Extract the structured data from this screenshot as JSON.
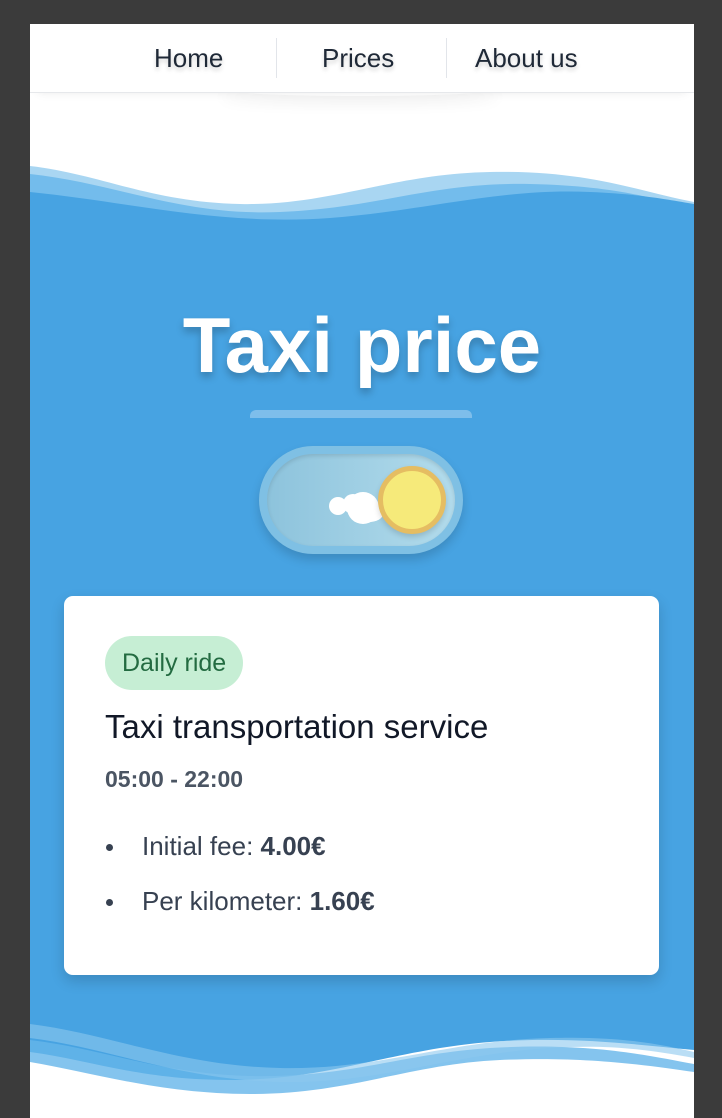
{
  "nav": {
    "items": [
      {
        "label": "Home"
      },
      {
        "label": "Prices"
      },
      {
        "label": "About us"
      }
    ]
  },
  "hero": {
    "title": "Taxi price",
    "toggle": {
      "state": "day",
      "icon_on": "sun-icon",
      "icon_off": "cloud-icon"
    }
  },
  "card": {
    "badge": "Daily ride",
    "title": "Taxi transportation service",
    "hours": "05:00 - 22:00",
    "prices": [
      {
        "label": "Initial fee: ",
        "value": "4.00€"
      },
      {
        "label": "Per kilometer: ",
        "value": "1.60€"
      }
    ]
  },
  "colors": {
    "hero_blue": "#47a3e2",
    "badge_bg": "#c6eed4",
    "badge_text": "#236b41",
    "sun": "#f6ea7a"
  }
}
